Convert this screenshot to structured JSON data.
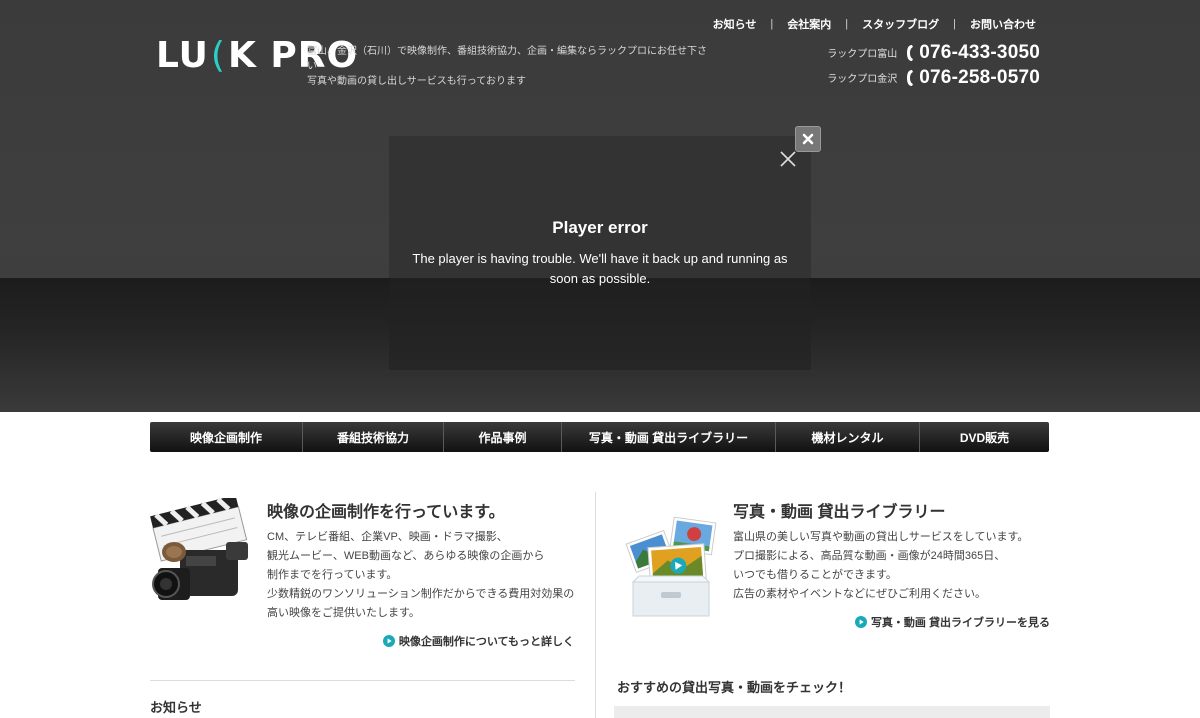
{
  "header": {
    "logo_left": "LU",
    "logo_accent": "(",
    "logo_right": "K PRO",
    "tagline_line1": "富山、金沢（石川）で映像制作、番組技術協力、企画・編集ならラックプロにお任せ下さい",
    "tagline_line2": "写真や動画の貸し出しサービスも行っております",
    "topnav": [
      "お知らせ",
      "会社案内",
      "スタッフブログ",
      "お問い合わせ"
    ],
    "topnav_separator": "|",
    "phones": [
      {
        "label": "ラックプロ富山",
        "number": "076-433-3050"
      },
      {
        "label": "ラックプロ金沢",
        "number": "076-258-0570"
      }
    ]
  },
  "player": {
    "title": "Player error",
    "message": "The player is having trouble. We'll have it back up and running as soon as possible.",
    "close_icon": "close-x-icon",
    "modal_close_icon": "close-icon"
  },
  "mainnav": [
    "映像企画制作",
    "番組技術協力",
    "作品事例",
    "写真・動画 貸出ライブラリー",
    "機材レンタル",
    "DVD販売"
  ],
  "left_section": {
    "title": "映像の企画制作を行っています。",
    "lines": [
      "CM、テレビ番組、企業VP、映画・ドラマ撮影、",
      "観光ムービー、WEB動画など、あらゆる映像の企画から",
      "制作までを行っています。",
      "少数精鋭のワンソリューション制作だからできる費用対効果の",
      "高い映像をご提供いたします。"
    ],
    "link": "映像企画制作についてもっと詳しく"
  },
  "right_section": {
    "title": "写真・動画 貸出ライブラリー",
    "lines": [
      "富山県の美しい写真や動画の貸出しサービスをしています。",
      "プロ撮影による、高品質な動画・画像が24時間365日、",
      "いつでも借りることができます。",
      "広告の素材やイベントなどにぜひご利用ください。"
    ],
    "link": "写真・動画 貸出ライブラリーを見る"
  },
  "news_title": "お知らせ",
  "reco_title": "おすすめの貸出写真・動画をチェック！",
  "colors": {
    "accent": "#2ad0c8",
    "link_icon": "#1aa9b8",
    "nav_bg": "#1a1a1a"
  }
}
